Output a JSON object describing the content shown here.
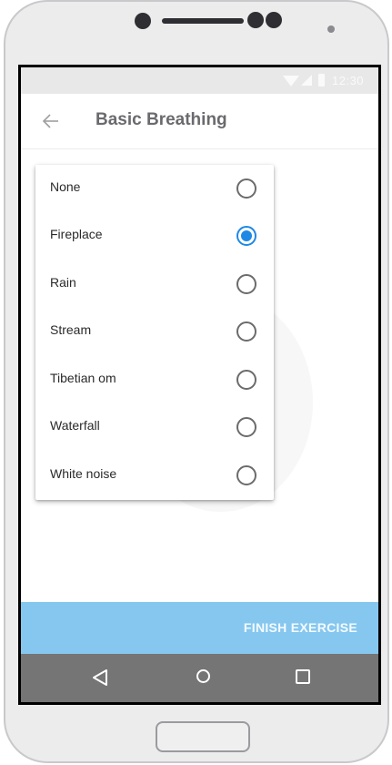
{
  "status_bar": {
    "time": "12:30"
  },
  "app_bar": {
    "title": "Basic Breathing"
  },
  "sound_options": [
    {
      "label": "None",
      "selected": false
    },
    {
      "label": "Fireplace",
      "selected": true
    },
    {
      "label": "Rain",
      "selected": false
    },
    {
      "label": "Stream",
      "selected": false
    },
    {
      "label": "Tibetian om",
      "selected": false
    },
    {
      "label": "Waterfall",
      "selected": false
    },
    {
      "label": "White noise",
      "selected": false
    }
  ],
  "finish_button": {
    "label": "FINISH EXERCISE"
  },
  "colors": {
    "accent": "#1e88e5",
    "finish_bar": "#86c7ef",
    "nav_bar": "#757575"
  },
  "icons": {
    "back": "arrow-left-icon",
    "nav_back": "triangle-back-icon",
    "nav_home": "circle-home-icon",
    "nav_recent": "square-recents-icon"
  }
}
